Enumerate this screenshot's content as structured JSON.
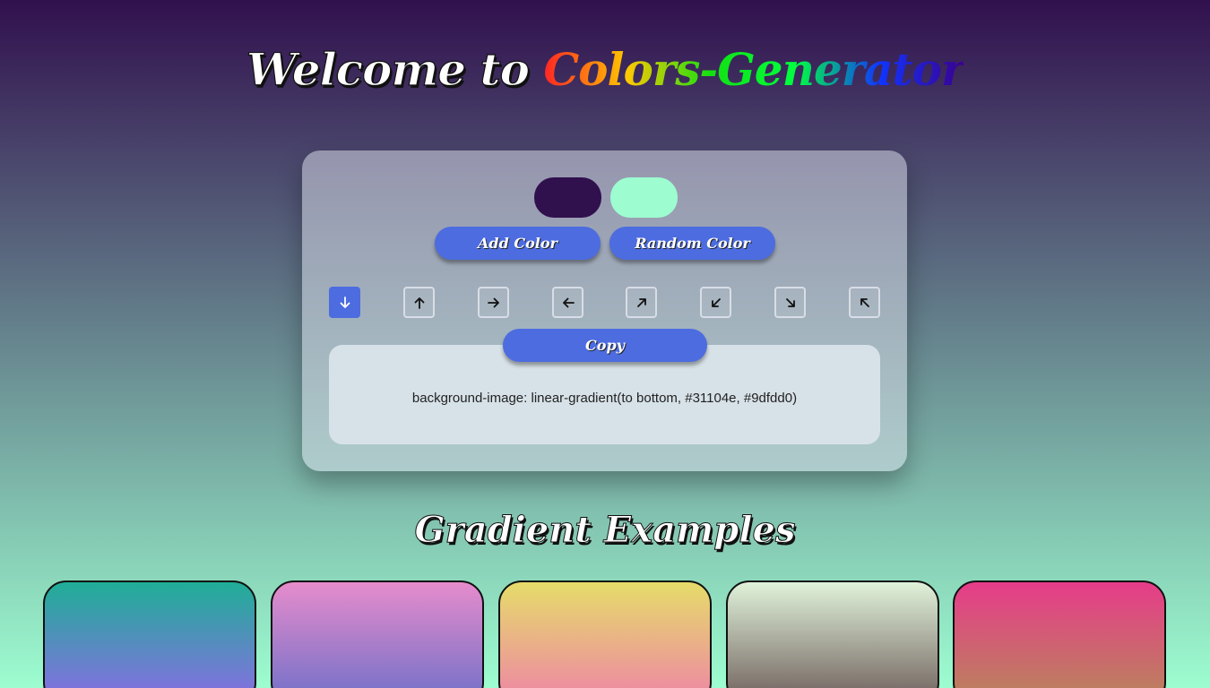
{
  "header": {
    "title_prefix": "Welcome to ",
    "title_brand": "Colors-Generator"
  },
  "generator": {
    "swatches": [
      {
        "name": "color-1",
        "color": "#31104e"
      },
      {
        "name": "color-2",
        "color": "#9dfdd0"
      }
    ],
    "add_color_label": "Add Color",
    "random_color_label": "Random Color",
    "directions": [
      {
        "icon": "arrow-down-icon",
        "value": "to bottom",
        "active": true
      },
      {
        "icon": "arrow-up-icon",
        "value": "to top",
        "active": false
      },
      {
        "icon": "arrow-right-icon",
        "value": "to right",
        "active": false
      },
      {
        "icon": "arrow-left-icon",
        "value": "to left",
        "active": false
      },
      {
        "icon": "arrow-up-right-icon",
        "value": "to top right",
        "active": false
      },
      {
        "icon": "arrow-down-left-icon",
        "value": "to bottom left",
        "active": false
      },
      {
        "icon": "arrow-down-right-icon",
        "value": "to bottom right",
        "active": false
      },
      {
        "icon": "arrow-up-left-icon",
        "value": "to top left",
        "active": false
      }
    ],
    "copy_label": "Copy",
    "css_output": "background-image: linear-gradient(to bottom, #31104e, #9dfdd0)"
  },
  "examples": {
    "title": "Gradient Examples",
    "items": [
      {
        "from": "#1fae96",
        "to": "#8b6be6"
      },
      {
        "from": "#e68ccc",
        "to": "#6f6fc8"
      },
      {
        "from": "#e6dc6a",
        "to": "#ee84a6"
      },
      {
        "from": "#e0f2da",
        "to": "#6e5e5a"
      },
      {
        "from": "#e63c8a",
        "to": "#b8865a"
      }
    ]
  },
  "colors": {
    "accent": "#4c6ce0"
  }
}
